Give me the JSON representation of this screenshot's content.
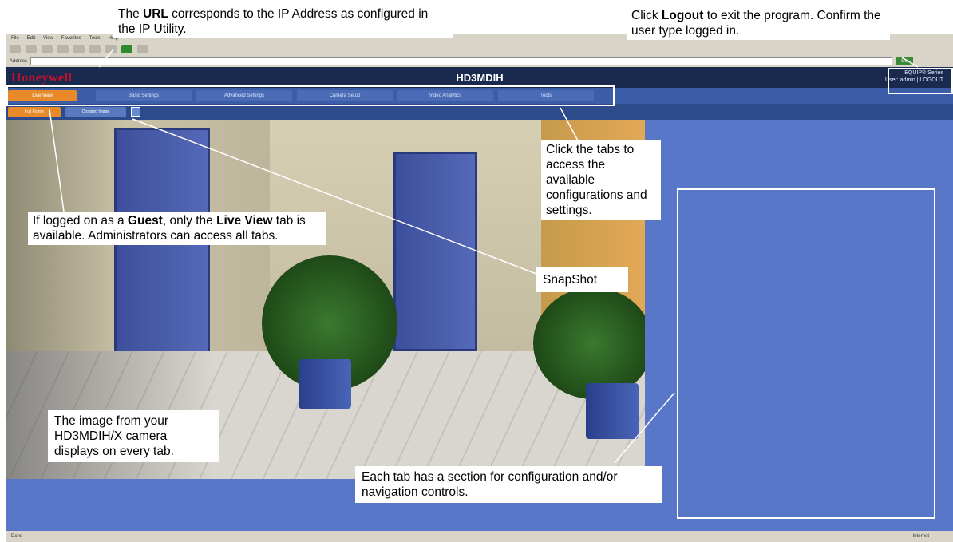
{
  "browser": {
    "menu_items": [
      "File",
      "Edit",
      "View",
      "Favorites",
      "Tools",
      "Help"
    ],
    "address_label": "Address",
    "go_label": "Go",
    "status_left": "Done",
    "status_right": "Internet"
  },
  "app": {
    "logo": "Honeywell",
    "title": "HD3MDIH",
    "series": "EQUIP® Series",
    "user_line": "User: admin | LOGOUT"
  },
  "tabs": [
    {
      "label": "Live View",
      "active": true
    },
    {
      "label": "Basic Settings",
      "active": false
    },
    {
      "label": "Advanced Settings",
      "active": false
    },
    {
      "label": "Camera Setup",
      "active": false
    },
    {
      "label": "Video Analytics",
      "active": false
    },
    {
      "label": "Tools",
      "active": false
    }
  ],
  "subtabs": [
    {
      "label": "Full Frame",
      "active": true
    },
    {
      "label": "Cropped Image",
      "active": false
    }
  ],
  "callouts": {
    "url": {
      "pre": "The ",
      "bold": "URL",
      "post": " corresponds to the IP Address as configured in the IP Utility."
    },
    "logout": {
      "pre": "Click ",
      "bold": "Logout",
      "post": " to exit the program. Confirm the user type logged in."
    },
    "tabs": "Click the tabs to access the available configurations and settings.",
    "guest": {
      "pre": "If logged on as a ",
      "bold1": "Guest",
      "mid": ", only the ",
      "bold2": "Live View",
      "post": " tab is available. Administrators can access all tabs."
    },
    "snapshot": "SnapShot",
    "image": "The image from your HD3MDIH/X camera displays on every tab.",
    "section": "Each tab has a section for configuration and/or navigation controls."
  },
  "colors": {
    "header_bg": "#1a2a4e",
    "logo_red": "#c8102e",
    "tab_active": "#e88a2a",
    "panel_blue": "#5877c8"
  }
}
